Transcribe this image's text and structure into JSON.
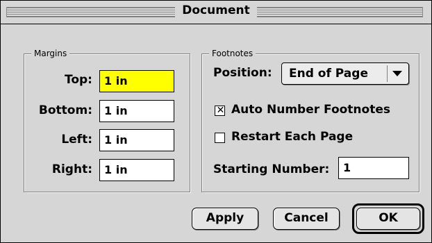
{
  "window": {
    "title": "Document"
  },
  "margins": {
    "label": "Margins",
    "fields": [
      {
        "label": "Top:",
        "value": "1 in"
      },
      {
        "label": "Bottom:",
        "value": "1 in"
      },
      {
        "label": "Left:",
        "value": "1 in"
      },
      {
        "label": "Right:",
        "value": "1 in"
      }
    ]
  },
  "footnotes": {
    "label": "Footnotes",
    "position_label": "Position:",
    "position_value": "End of Page",
    "auto_number_label": "Auto Number Footnotes",
    "auto_number_checked": true,
    "auto_number_mark": "✕",
    "restart_label": "Restart Each Page",
    "restart_checked": false,
    "starting_label": "Starting Number:",
    "starting_value": "1"
  },
  "buttons": {
    "apply": "Apply",
    "cancel": "Cancel",
    "ok": "OK"
  },
  "colors": {
    "highlight": "#ffff00",
    "window_bg": "#d6d6d6"
  }
}
